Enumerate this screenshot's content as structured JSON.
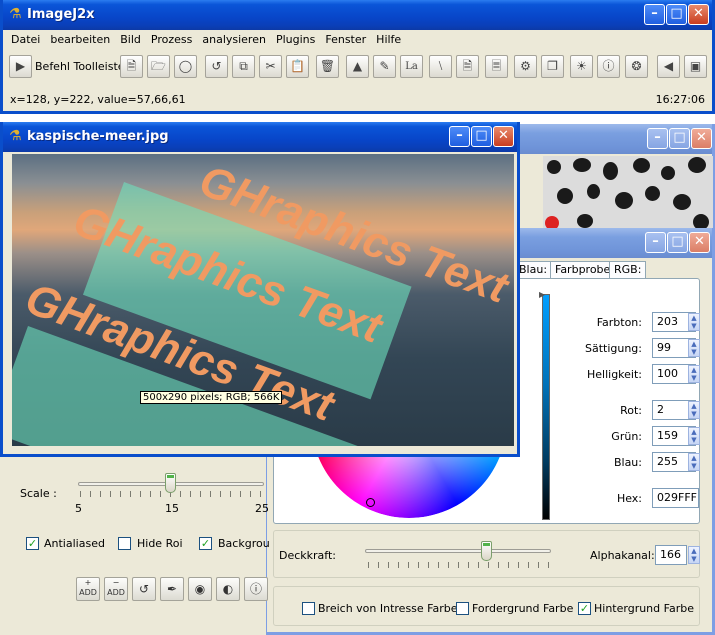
{
  "main": {
    "title": "ImageJ2x",
    "menu": [
      "Datei",
      "bearbeiten",
      "Bild",
      "Prozess",
      "analysieren",
      "Plugins",
      "Fenster",
      "Hilfe"
    ],
    "toolbar_label": "Befehl Toolleiste",
    "status_left": "x=128, y=222, value=57,66,61",
    "status_time": "16:27:06"
  },
  "image_window": {
    "title": "kaspische-meer.jpg",
    "overlay_text": "GHraphics Text",
    "info": "500x290 pixels; RGB; 566K"
  },
  "color_dialog": {
    "tabs": [
      "Blau:",
      "Farbprobe",
      "RGB:"
    ],
    "fields": [
      {
        "label": "Farbton:",
        "value": "203"
      },
      {
        "label": "Sättigung:",
        "value": "99"
      },
      {
        "label": "Helligkeit:",
        "value": "100"
      },
      {
        "label": "Rot:",
        "value": "2"
      },
      {
        "label": "Grün:",
        "value": "159"
      },
      {
        "label": "Blau:",
        "value": "255"
      }
    ],
    "hex_label": "Hex:",
    "hex_value": "029FFF",
    "opacity_label": "Deckkraft:",
    "alpha_label": "Alphakanal:",
    "alpha_value": "166",
    "opacity_level": 0.65,
    "checkboxes": [
      {
        "label": "Breich von Intresse Farbe",
        "checked": false
      },
      {
        "label": "Fordergrund Farbe",
        "checked": false
      },
      {
        "label": "Hintergrund Farbe",
        "checked": true
      }
    ],
    "selected_color": "#029FFF"
  },
  "text_dialog": {
    "scale_label": "Scale :",
    "scale_ticks": [
      "5",
      "15",
      "25"
    ],
    "scale_value": 15,
    "checkboxes": [
      {
        "label": "Antialiased",
        "checked": true
      },
      {
        "label": "Hide Roi",
        "checked": false
      },
      {
        "label": "Backgrou",
        "checked": true
      }
    ],
    "button_labels": [
      "ADD",
      "ADD"
    ]
  }
}
